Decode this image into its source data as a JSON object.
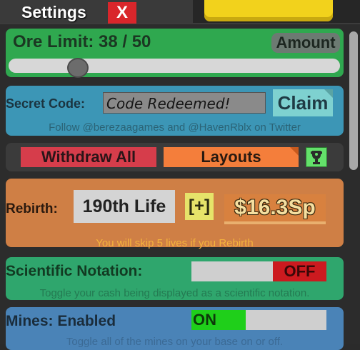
{
  "window": {
    "title": "Settings",
    "close_label": "X"
  },
  "ore": {
    "label": "Ore Limit: 38 / 50",
    "amount_label": "Amount",
    "slider_value": 0.2
  },
  "secret_code": {
    "label": "Secret Code:",
    "input_value": "Code Redeemed!",
    "claim_label": "Claim",
    "info": "Follow @berezaagames and @HavenRblx on Twitter"
  },
  "actions": {
    "withdraw_label": "Withdraw All",
    "layouts_label": "Layouts",
    "trophy_icon": "trophy-icon"
  },
  "rebirth": {
    "label": "Rebirth:",
    "life": "190th Life",
    "plus_label": "[+]",
    "cost": "$16.3Sp",
    "note": "You will skip 5 lives if you Rebirth"
  },
  "scientific": {
    "label": "Scientific Notation:",
    "state": "OFF",
    "note": "Toggle your cash being displayed as a scientific notation."
  },
  "mines": {
    "label": "Mines: Enabled",
    "state": "ON",
    "note": "Toggle all of the mines on your base on or off."
  },
  "colors": {
    "ore_card": "#2fa84f",
    "code_card": "#3c96b6",
    "rebirth_card": "#cf7f45",
    "sci_card": "#2fa66d",
    "mines_card": "#4a83b7",
    "close": "#d9262b"
  }
}
